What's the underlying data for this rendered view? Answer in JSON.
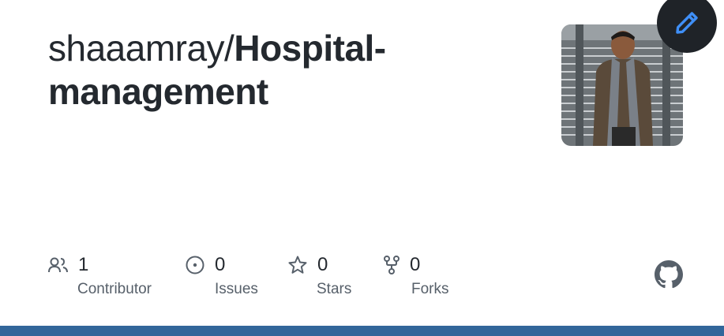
{
  "repo": {
    "owner": "shaaamray/",
    "name_line1": "Hospital-",
    "name_line2": "management"
  },
  "stats": {
    "contributors": {
      "value": "1",
      "label": "Contributor",
      "icon": "people-icon"
    },
    "issues": {
      "value": "0",
      "label": "Issues",
      "icon": "issue-opened-icon"
    },
    "stars": {
      "value": "0",
      "label": "Stars",
      "icon": "star-icon"
    },
    "forks": {
      "value": "0",
      "label": "Forks",
      "icon": "repo-forked-icon"
    }
  },
  "icons": {
    "edit": "pencil-icon",
    "brand": "github-logo-icon"
  },
  "colors": {
    "text": "#24292f",
    "muted": "#57606a",
    "accent_bar": "#32669a",
    "edit_button_bg": "#1f2328",
    "edit_icon": "#3f8ff7"
  }
}
